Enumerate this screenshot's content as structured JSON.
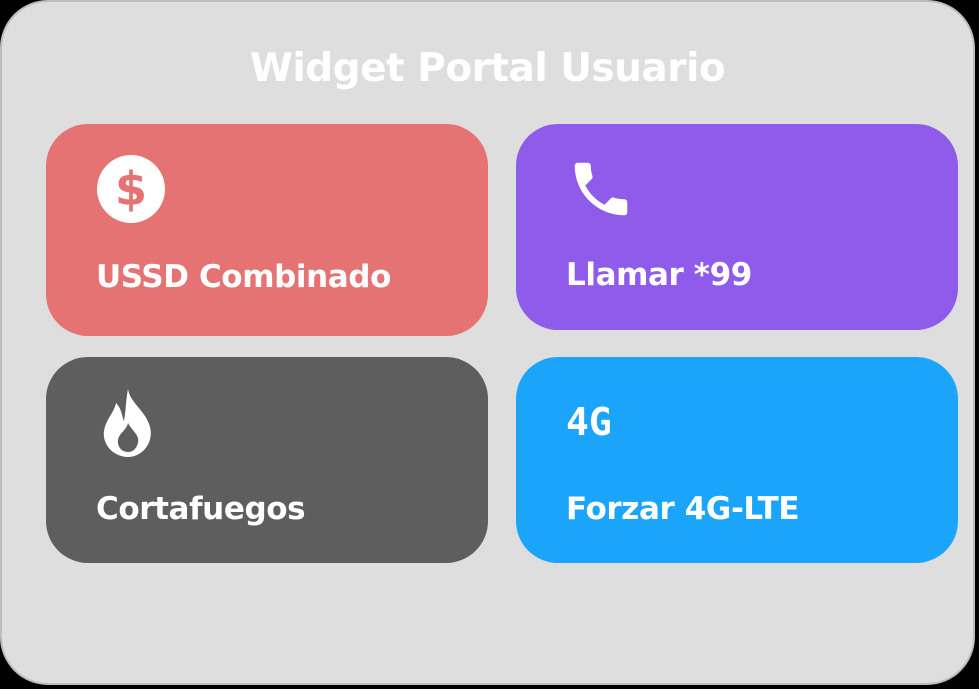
{
  "widget": {
    "title": "Widget Portal Usuario",
    "background": "#dedede"
  },
  "tiles": [
    {
      "label": "USSD Combinado",
      "icon": "dollar-circle-icon",
      "color": "#e57373"
    },
    {
      "label": "Llamar *99",
      "icon": "phone-icon",
      "color": "#8e5bea"
    },
    {
      "label": "Cortafuegos",
      "icon": "flame-icon",
      "color": "#5e5e5e"
    },
    {
      "label": "Forzar 4G-LTE",
      "icon": "4g-icon",
      "color": "#1aa5fb"
    }
  ]
}
